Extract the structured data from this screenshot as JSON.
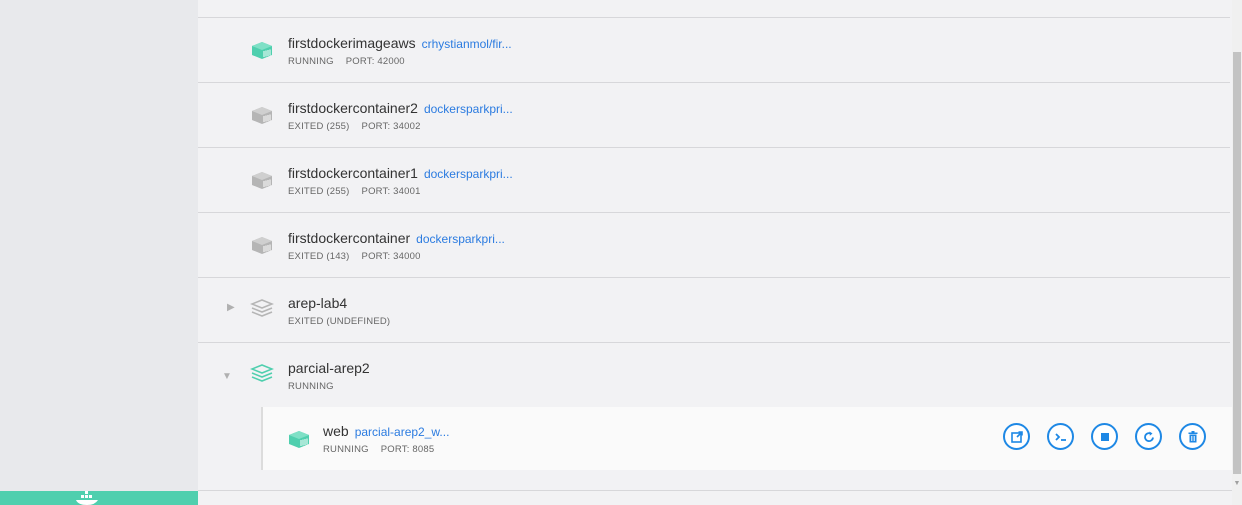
{
  "colors": {
    "running": "#4fcfae",
    "exited": "#b5b5b5",
    "link": "#2b7be0",
    "action": "#1e88e5"
  },
  "containers": [
    {
      "name": "firstdockerimageaws",
      "image": "crhystianmol/fir...",
      "status": "RUNNING",
      "port": "PORT: 42000",
      "state": "running"
    },
    {
      "name": "firstdockercontainer2",
      "image": "dockersparkpri...",
      "status": "EXITED (255)",
      "port": "PORT: 34002",
      "state": "exited"
    },
    {
      "name": "firstdockercontainer1",
      "image": "dockersparkpri...",
      "status": "EXITED (255)",
      "port": "PORT: 34001",
      "state": "exited"
    },
    {
      "name": "firstdockercontainer",
      "image": "dockersparkpri...",
      "status": "EXITED (143)",
      "port": "PORT: 34000",
      "state": "exited"
    }
  ],
  "apps": [
    {
      "name": "arep-lab4",
      "status": "EXITED (UNDEFINED)",
      "expanded": false
    },
    {
      "name": "parcial-arep2",
      "status": "RUNNING",
      "expanded": true
    }
  ],
  "child": {
    "name": "web",
    "image": "parcial-arep2_w...",
    "status": "RUNNING",
    "port": "PORT: 8085"
  },
  "actions": [
    "open-in-browser",
    "cli",
    "stop",
    "restart",
    "delete"
  ]
}
